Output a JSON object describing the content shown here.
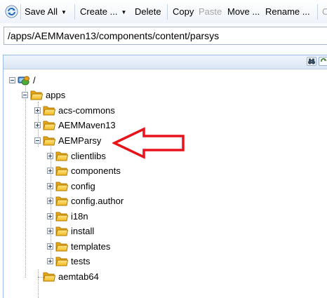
{
  "toolbar": {
    "save_all": "Save All",
    "create": "Create ...",
    "delete": "Delete",
    "copy": "Copy",
    "paste": "Paste",
    "move": "Move ...",
    "rename": "Rename ...",
    "cut_off": "C"
  },
  "path_field": {
    "value": "/apps/AEMMaven13/components/content/parsys"
  },
  "tree": {
    "root": "/",
    "apps": "apps",
    "acs_commons": "acs-commons",
    "aemmaven13": "AEMMaven13",
    "aemparsy": "AEMParsy",
    "clientlibs": "clientlibs",
    "components": "components",
    "config": "config",
    "config_author": "config.author",
    "i18n": "i18n",
    "install": "install",
    "templates": "templates",
    "tests": "tests",
    "aemtab64": "aemtab64"
  },
  "colors": {
    "annotation_arrow": "#e8141b",
    "folder": "#f2c230",
    "selection_border": "#99bbe8"
  }
}
